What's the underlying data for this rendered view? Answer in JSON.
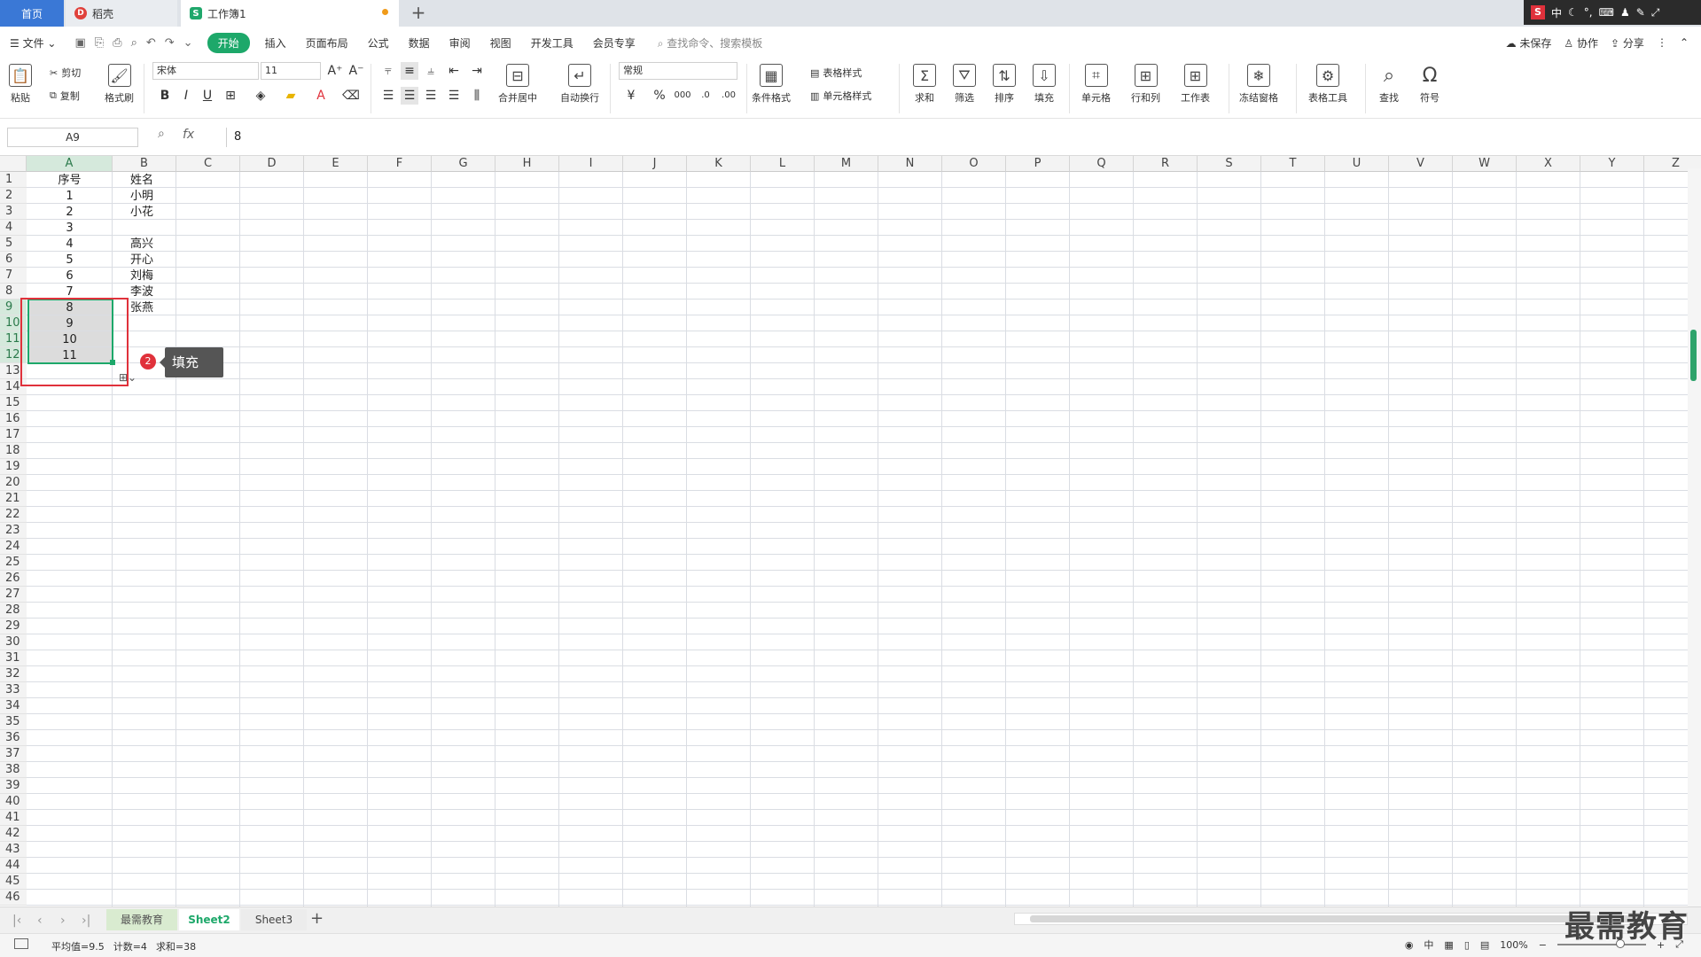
{
  "tabs": {
    "home": "首页",
    "daoke": "稻壳",
    "book": "工作簿1",
    "add": "+"
  },
  "ime": {
    "lang": "中",
    "s": "S"
  },
  "menu": {
    "file": "文件",
    "items": [
      "开始",
      "插入",
      "页面布局",
      "公式",
      "数据",
      "审阅",
      "视图",
      "开发工具",
      "会员专享"
    ],
    "active_index": 0,
    "search_placeholder": "查找命令、搜索模板",
    "unsaved": "未保存",
    "collab": "协作",
    "share": "分享"
  },
  "ribbon": {
    "paste": "粘贴",
    "cut": "剪切",
    "copy": "复制",
    "format_painter": "格式刷",
    "font_name": "宋体",
    "font_size": "11",
    "bold": "B",
    "italic": "I",
    "underline": "U",
    "merge": "合并居中",
    "wrap": "自动换行",
    "number_format": "常规",
    "currency": "¥",
    "percent": "%",
    "cond_format": "条件格式",
    "table_style": "表格样式",
    "cell_style": "单元格样式",
    "sum": "求和",
    "filter": "筛选",
    "sort": "排序",
    "fill": "填充",
    "cell": "单元格",
    "rowcol": "行和列",
    "sheet": "工作表",
    "freeze": "冻结窗格",
    "tools": "表格工具",
    "find": "查找",
    "symbol": "符号"
  },
  "formula_bar": {
    "name_box": "A9",
    "fx": "fx",
    "value": "8"
  },
  "columns": [
    "A",
    "B",
    "C",
    "D",
    "E",
    "F",
    "G",
    "H",
    "I",
    "J",
    "K",
    "L",
    "M",
    "N",
    "O",
    "P",
    "Q",
    "R",
    "S",
    "T",
    "U",
    "V",
    "W",
    "X",
    "Y",
    "Z"
  ],
  "selected_column": "A",
  "rows_visible": 46,
  "selected_rows": [
    9,
    10,
    11,
    12
  ],
  "cells": {
    "A1": "序号",
    "B1": "姓名",
    "A2": "1",
    "B2": "小明",
    "A3": "2",
    "B3": "小花",
    "A4": "3",
    "A5": "4",
    "B5": "高兴",
    "A6": "5",
    "B6": "开心",
    "A7": "6",
    "B7": "刘梅",
    "A8": "7",
    "B8": "李波",
    "A9": "8",
    "B9": "张燕",
    "A10": "9",
    "A11": "10",
    "A12": "11"
  },
  "annotation": {
    "badge": "2",
    "tooltip": "填充"
  },
  "sheets": {
    "tabs": [
      "最需教育",
      "Sheet2",
      "Sheet3"
    ],
    "active": "Sheet2"
  },
  "status": {
    "avg": "平均值=9.5",
    "count": "计数=4",
    "sum": "求和=38",
    "zoom": "100%",
    "ime": "中"
  },
  "watermark": "最需教育",
  "colors": {
    "accent": "#1da86a",
    "highlight_red": "#e0313b",
    "tab_blue": "#3a78d6"
  }
}
